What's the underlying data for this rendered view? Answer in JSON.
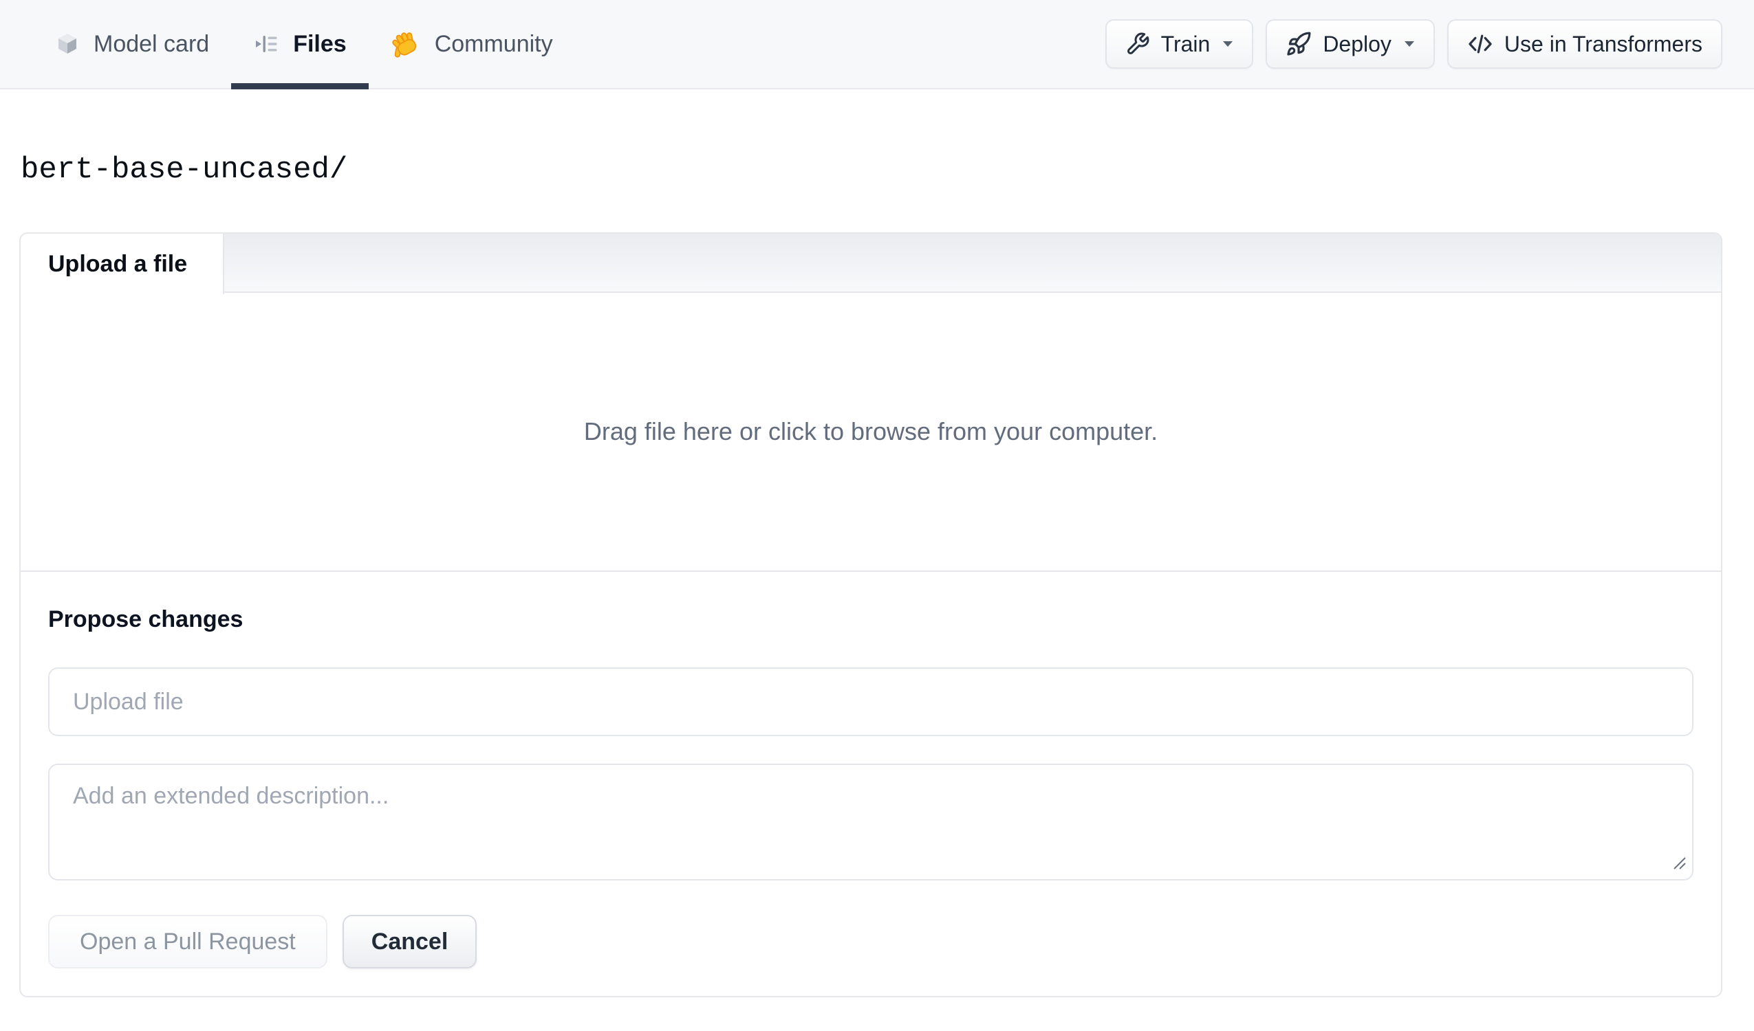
{
  "header": {
    "nav": [
      {
        "label": "Model card",
        "icon": "cube-icon",
        "active": false
      },
      {
        "label": "Files",
        "icon": "files-list-icon",
        "active": true
      },
      {
        "label": "Community",
        "icon": "waving-hand-icon",
        "active": false
      }
    ],
    "actions": {
      "train_label": "Train",
      "deploy_label": "Deploy",
      "use_in_transformers_label": "Use in Transformers"
    }
  },
  "repo": {
    "path_title": "bert-base-uncased/"
  },
  "upload": {
    "tab_label": "Upload a file",
    "dropzone_hint": "Drag file here or click to browse from your computer.",
    "propose_heading": "Propose changes",
    "file_input": {
      "value": "",
      "placeholder": "Upload file"
    },
    "description_input": {
      "value": "",
      "placeholder": "Add an extended description..."
    },
    "open_pr_label": "Open a Pull Request",
    "cancel_label": "Cancel"
  },
  "colors": {
    "header_background": "#f7f8fa",
    "active_tab_underline": "#313c4e",
    "panel_border": "#e5e7eb",
    "hint_text": "#626c7c",
    "placeholder_text": "#a0a7b3",
    "hand_emoji_yellow": "#fbbf24",
    "hand_emoji_outline": "#f0960e"
  }
}
